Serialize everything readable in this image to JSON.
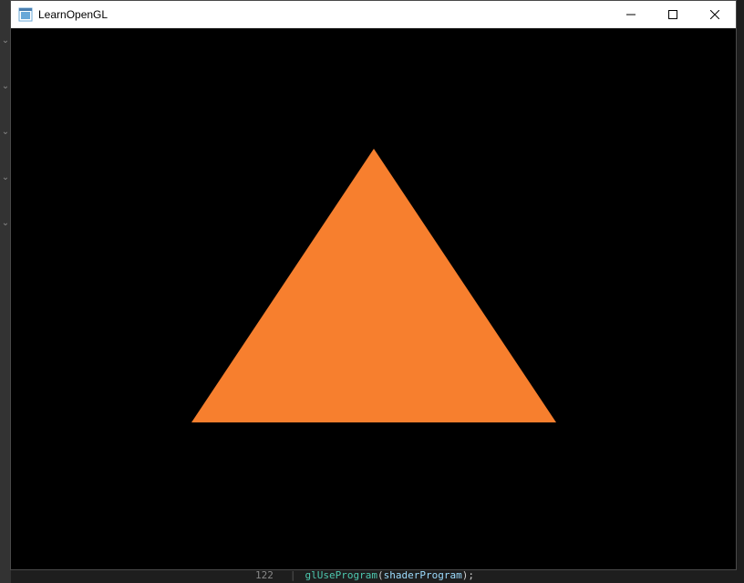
{
  "window": {
    "title": "LearnOpenGL"
  },
  "viewport": {
    "triangle_color": "#f77f2e",
    "background_color": "#000000"
  },
  "editor_peek": {
    "line_number": "122",
    "code_fn": "glUseProgram",
    "code_arg": "shaderProgram",
    "code_tail": ");"
  }
}
